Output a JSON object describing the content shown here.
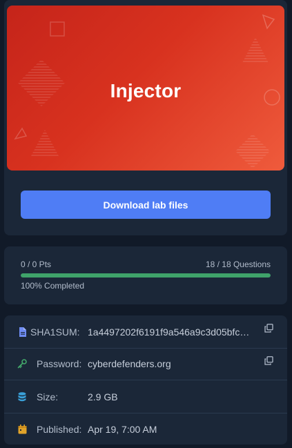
{
  "hero": {
    "title": "Injector",
    "download_label": "Download lab files"
  },
  "progress": {
    "points": "0 / 0 Pts",
    "questions": "18 / 18 Questions",
    "completed_label": "100% Completed",
    "percent": 100,
    "fill_color": "#3fa36a"
  },
  "info": {
    "sha1": {
      "label": "SHA1SUM:",
      "value": "1a4497202f6191f9a546a9c3d05bfc…",
      "icon": "document-icon"
    },
    "password": {
      "label": "Password:",
      "value": "cyberdefenders.org",
      "icon": "key-icon"
    },
    "size": {
      "label": "Size:",
      "value": "2.9 GB",
      "icon": "database-icon"
    },
    "published": {
      "label": "Published:",
      "value": "Apr 19, 7:00 AM",
      "icon": "calendar-icon"
    }
  },
  "colors": {
    "background": "#111a28",
    "card": "#1b2738",
    "accent_button": "#4f7df5",
    "banner_start": "#c5241a",
    "banner_end": "#ef5b3c"
  }
}
